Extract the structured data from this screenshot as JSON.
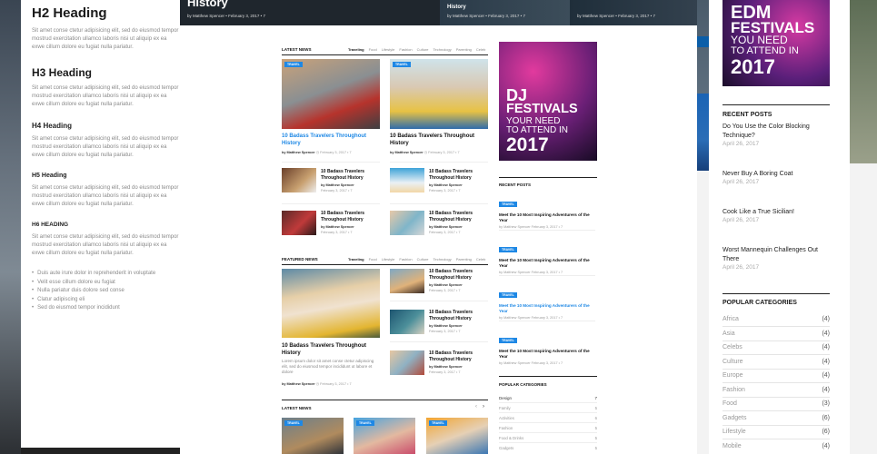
{
  "left": {
    "h2": "H2 Heading",
    "h3": "H3 Heading",
    "h4": "H4 Heading",
    "h5": "H5 Heading",
    "h6": "H6 HEADING",
    "para": [
      "Sit amet conse ctetur adipisicing elit, sed do eiusmod tempor",
      "mostrud exercitation ullamco laboris nisi ut aliquip ex ea",
      "exwe cillum dolore eu fugiat nulla pariatur."
    ],
    "list": [
      "Duis aute irure dolor in reprehenderit in voluptate",
      "Velit esse cillum dolore eu fugiat",
      "Nulla pariatur duis dolore sed conse",
      "Clatur adipiscing eli",
      "Sed do eiusmod tempor incididunt"
    ]
  },
  "hero": {
    "title": "History",
    "meta1": "by Matthew Spencer   •   February 3, 2017   •   7",
    "item2_title": "History",
    "meta2": "by Matthew Spencer   •   February 3, 2017   •   7",
    "meta3": "by Matthew Spencer   •   February 3, 2017   •   7"
  },
  "latest": {
    "heading": "LATEST NEWS",
    "tabs": [
      "Traveling",
      "Food",
      "Lifestyle",
      "Fashion",
      "Culture",
      "Technology",
      "Parenting",
      "Celeb"
    ],
    "main": [
      {
        "tag": "TRAVEL",
        "title": "10 Badass Travelers Throughout History",
        "meta_by": "by Matthew Spencer",
        "meta_date": "February 3, 2017",
        "meta_c": "7"
      },
      {
        "tag": "TRAVEL",
        "title": "10 Badass Travelers Throughout History",
        "meta_by": "by Matthew Spencer",
        "meta_date": "February 3, 2017",
        "meta_c": "7"
      }
    ],
    "small": [
      {
        "title": "10 Badass Travelers Throughout History",
        "by": "by Matthew Spencer",
        "date": "February 3, 2017   •   7"
      },
      {
        "title": "10 Badass Travelers Throughout History",
        "by": "by Matthew Spencer",
        "date": "February 3, 2017   •   7"
      },
      {
        "title": "10 Badass Travelers Throughout History",
        "by": "by Matthew Spencer",
        "date": "February 3, 2017   •   7"
      },
      {
        "title": "10 Badass Travelers Throughout History",
        "by": "by Matthew Spencer",
        "date": "February 3, 2017   •   7"
      }
    ]
  },
  "featured": {
    "heading": "FEATURED NEWS",
    "tabs": [
      "Traveling",
      "Food",
      "Lifestyle",
      "Fashion",
      "Culture",
      "Technology",
      "Parenting",
      "Celeb"
    ],
    "main": {
      "title": "10 Badass Travelers Throughout History",
      "excerpt": "Lorem ipsum dolor sit amet conse ctetur adipiscing elit, sed do eiusmod tempor incididunt ut labore et dolore",
      "by": "by Matthew Spencer",
      "date": "February 3, 2017   •   7"
    },
    "small": [
      {
        "title": "10 Badass Travelers Throughout History",
        "by": "by Matthew Spencer",
        "date": "February 3, 2017   •   7"
      },
      {
        "title": "10 Badass Travelers Throughout History",
        "by": "by Matthew Spencer",
        "date": "February 3, 2017   •   7"
      },
      {
        "title": "10 Badass Travelers Throughout History",
        "by": "by Matthew Spencer",
        "date": "February 3, 2017   •   7"
      }
    ]
  },
  "latest2": {
    "heading": "LATEST NEWS",
    "tags": [
      "TRAVEL",
      "TRAVEL",
      "TRAVEL"
    ]
  },
  "ad": {
    "l1": "DJ",
    "l2": "FESTIVALS",
    "l3": "YOUR NEED",
    "l4": "TO ATTEND IN",
    "l5": "2017"
  },
  "sidebar": {
    "recent_heading": "RECENT POSTS",
    "recent": [
      {
        "tag": "TRAVEL",
        "title": "Meet the 10 Most Inspiring Adventurers of the Year",
        "meta": "by Matthew Spencer   February 3, 2017   •   7"
      },
      {
        "tag": "TRAVEL",
        "title": "Meet the 10 Most Inspiring Adventurers of the Year",
        "meta": "by Matthew Spencer   February 3, 2017   •   7"
      },
      {
        "tag": "TRAVEL",
        "title": "Meet the 10 Most Inspiring Adventurers of the Year",
        "meta": "by Matthew Spencer   February 3, 2017   •   7"
      },
      {
        "tag": "TRAVEL",
        "title": "Meet the 10 Most Inspiring Adventurers of the Year",
        "meta": "by Matthew Spencer   February 3, 2017   •   7"
      }
    ],
    "cat_heading": "POPULAR CATEGORIES",
    "cats": [
      {
        "name": "Design",
        "n": "7"
      },
      {
        "name": "Family",
        "n": "5"
      },
      {
        "name": "Activities",
        "n": "6"
      },
      {
        "name": "Fashion",
        "n": "5"
      },
      {
        "name": "Food & Drinks",
        "n": "5"
      },
      {
        "name": "Gadgets",
        "n": "5"
      }
    ]
  },
  "right": {
    "ad": {
      "l1": "EDM",
      "l2": "FESTIVALS",
      "l3": "YOU NEED",
      "l4": "TO ATTEND IN",
      "l5": "2017"
    },
    "recent_heading": "RECENT POSTS",
    "recent": [
      {
        "title": "Do You Use the Color Blocking Technique?",
        "date": "April 26, 2017"
      },
      {
        "title": "Never Buy A Boring Coat",
        "date": "April 26, 2017"
      },
      {
        "title": "Cook Like a True Sicilian!",
        "date": "April 26, 2017"
      },
      {
        "title": "Worst Mannequin Challenges Out There",
        "date": "April 26, 2017"
      }
    ],
    "cat_heading": "POPULAR CATEGORIES",
    "cats": [
      {
        "name": "Africa",
        "n": "(4)"
      },
      {
        "name": "Asia",
        "n": "(4)"
      },
      {
        "name": "Celebs",
        "n": "(4)"
      },
      {
        "name": "Culture",
        "n": "(4)"
      },
      {
        "name": "Europe",
        "n": "(4)"
      },
      {
        "name": "Fashion",
        "n": "(4)"
      },
      {
        "name": "Food",
        "n": "(3)"
      },
      {
        "name": "Gadgets",
        "n": "(6)"
      },
      {
        "name": "Lifestyle",
        "n": "(6)"
      },
      {
        "name": "Mobile",
        "n": "(4)"
      }
    ]
  }
}
